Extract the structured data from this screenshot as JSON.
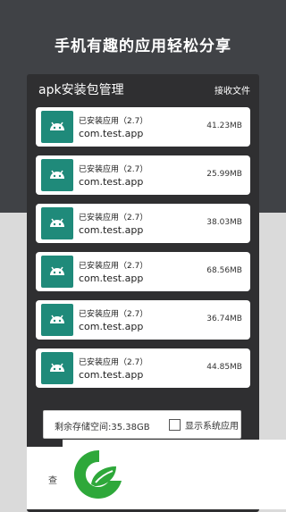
{
  "promo": {
    "headline": "手机有趣的应用轻松分享"
  },
  "appbar": {
    "title": "apk安装包管理",
    "action": "接收文件"
  },
  "apps": [
    {
      "name": "已安装应用（2.7）",
      "package": "com.test.app",
      "size": "41.23MB",
      "icon": "android-icon"
    },
    {
      "name": "已安装应用（2.7）",
      "package": "com.test.app",
      "size": "25.99MB",
      "icon": "android-icon"
    },
    {
      "name": "已安装应用（2.7）",
      "package": "com.test.app",
      "size": "38.03MB",
      "icon": "android-icon"
    },
    {
      "name": "已安装应用（2.7）",
      "package": "com.test.app",
      "size": "68.56MB",
      "icon": "android-icon"
    },
    {
      "name": "已安装应用（2.7）",
      "package": "com.test.app",
      "size": "36.74MB",
      "icon": "android-icon"
    },
    {
      "name": "已安装应用（2.7）",
      "package": "com.test.app",
      "size": "44.85MB",
      "icon": "android-icon"
    }
  ],
  "storage": {
    "remaining": "剩余存储空间:35.38GB",
    "show_system_label": "显示系统应用",
    "show_system_checked": false
  },
  "bottom_tab": {
    "label": "查"
  },
  "colors": {
    "top_band": "#404246",
    "panel": "#2f2f31",
    "icon_bg": "#1f8a7a",
    "logo_green": "#2ea83a"
  }
}
